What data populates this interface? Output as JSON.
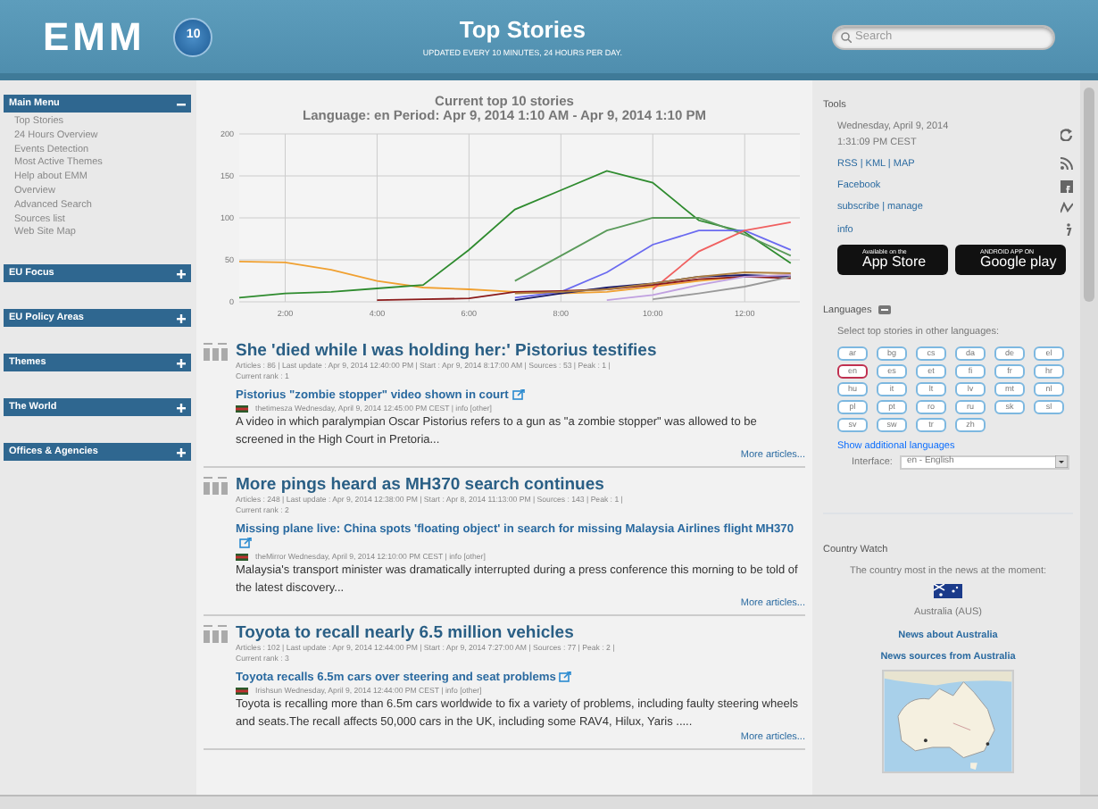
{
  "header": {
    "logo": "EMM",
    "badge": "10",
    "title": "Top Stories",
    "subtitle": "UPDATED EVERY 10 MINUTES, 24 HOURS PER DAY.",
    "search": {
      "placeholder": "Search"
    }
  },
  "sidebar": {
    "panels": [
      {
        "title": "Main Menu",
        "expanded": true,
        "items": [
          "Top Stories",
          "24 Hours Overview",
          "Events Detection",
          "Most Active Themes",
          "Help about EMM",
          "Overview",
          "Advanced Search",
          "Sources list",
          "Web Site Map"
        ]
      },
      {
        "title": "EU Focus",
        "expanded": false
      },
      {
        "title": "EU Policy Areas",
        "expanded": false
      },
      {
        "title": "Themes",
        "expanded": false
      },
      {
        "title": "The World",
        "expanded": false
      },
      {
        "title": "Offices & Agencies",
        "expanded": false
      }
    ]
  },
  "chart": {
    "chart_data": {
      "type": "line",
      "grid": true,
      "title": "Current top 10 stories",
      "subtitle": "Language: en Period: Apr 9, 2014 1:10 AM - Apr 9, 2014 1:10 PM",
      "x": [
        1,
        2,
        3,
        4,
        5,
        6,
        7,
        8,
        9,
        10,
        11,
        12,
        13
      ],
      "xlim": [
        1,
        13.2
      ],
      "ylim": [
        0,
        200
      ],
      "yticks": [
        0,
        50,
        100,
        150,
        200
      ],
      "xticks": [
        {
          "value": 2,
          "label": "2:00"
        },
        {
          "value": 4,
          "label": "4:00"
        },
        {
          "value": 6,
          "label": "6:00"
        },
        {
          "value": 8,
          "label": "8:00"
        },
        {
          "value": 10,
          "label": "10:00"
        },
        {
          "value": 12,
          "label": "12:00"
        }
      ],
      "series": [
        {
          "color": "#f0a030",
          "values": [
            48,
            47,
            38,
            25,
            17,
            15,
            12,
            10,
            12,
            18,
            25,
            30,
            32
          ]
        },
        {
          "color": "#2e8b2e",
          "values": [
            5,
            10,
            12,
            16,
            20,
            62,
            110,
            133,
            156,
            142,
            97,
            83,
            46
          ]
        },
        {
          "color": "#5a9a5a",
          "values": [
            null,
            null,
            null,
            null,
            null,
            null,
            25,
            55,
            85,
            100,
            100,
            80,
            55
          ]
        },
        {
          "color": "#6a6af0",
          "values": [
            null,
            null,
            null,
            null,
            null,
            null,
            5,
            12,
            35,
            68,
            85,
            85,
            62
          ]
        },
        {
          "color": "#f06060",
          "values": [
            null,
            null,
            null,
            null,
            null,
            null,
            null,
            null,
            null,
            15,
            60,
            85,
            95
          ]
        },
        {
          "color": "#8b1a1a",
          "values": [
            null,
            null,
            null,
            2,
            3,
            4,
            12,
            13,
            15,
            20,
            27,
            30,
            28
          ]
        },
        {
          "color": "#1a1a6a",
          "values": [
            null,
            null,
            null,
            null,
            null,
            null,
            2,
            10,
            17,
            22,
            30,
            32,
            30
          ]
        },
        {
          "color": "#999999",
          "values": [
            null,
            null,
            null,
            null,
            null,
            null,
            null,
            null,
            null,
            3,
            10,
            18,
            30
          ]
        },
        {
          "color": "#c0a0e0",
          "values": [
            null,
            null,
            null,
            null,
            null,
            null,
            null,
            null,
            2,
            8,
            20,
            30,
            32
          ]
        },
        {
          "color": "#b08040",
          "values": [
            null,
            null,
            null,
            null,
            null,
            null,
            10,
            12,
            15,
            22,
            30,
            35,
            34
          ]
        }
      ]
    }
  },
  "stories": [
    {
      "title": "She 'died while I was holding her:' Pistorius testifies",
      "meta": "Articles : 86 | Last update : Apr 9, 2014 12:40:00 PM | Start : Apr 9, 2014 8:17:00 AM | Sources : 53 | Peak : 1 |",
      "rank": "Current rank : 1",
      "article": {
        "title": "Pistorius \"zombie stopper\" video shown in court",
        "source": "thetimesza Wednesday, April 9, 2014 12:45:00 PM CEST | info [other]",
        "text": "A video in which paralympian Oscar Pistorius refers to a gun as \"a zombie stopper\" was allowed to be screened in the High Court in Pretoria..."
      },
      "more": "More articles..."
    },
    {
      "title": "More pings heard as MH370 search continues",
      "meta": "Articles : 248 | Last update : Apr 9, 2014 12:38:00 PM | Start : Apr 8, 2014 11:13:00 PM | Sources : 143 | Peak : 1 |",
      "rank": "Current rank : 2",
      "article": {
        "title": "Missing plane live: China spots 'floating object' in search for missing Malaysia Airlines flight MH370",
        "source": "theMirror Wednesday, April 9, 2014 12:10:00 PM CEST | info [other]",
        "text": "Malaysia's transport minister was dramatically interrupted during a press conference this morning to be told of the latest discovery..."
      },
      "more": "More articles..."
    },
    {
      "title": "Toyota to recall nearly 6.5 million vehicles",
      "meta": "Articles : 102 | Last update : Apr 9, 2014 12:44:00 PM | Start : Apr 9, 2014 7:27:00 AM | Sources : 77 | Peak : 2 |",
      "rank": "Current rank : 3",
      "article": {
        "title": "Toyota recalls 6.5m cars over steering and seat problems",
        "source": "Irishsun Wednesday, April 9, 2014 12:44:00 PM CEST | info [other]",
        "text": "Toyota is recalling more than 6.5m cars worldwide to fix a variety of problems, including faulty steering wheels and seats.The recall affects 50,000 cars in the UK, including some RAV4, Hilux, Yaris ....."
      },
      "more": "More articles..."
    }
  ],
  "tools": {
    "heading": "Tools",
    "date": "Wednesday, April 9, 2014",
    "time": "1:31:09 PM CEST",
    "links": [
      "RSS | KML | MAP",
      "Facebook",
      "subscribe | manage",
      "info"
    ],
    "stores": [
      {
        "small": "Available on the",
        "big": "App Store"
      },
      {
        "small": "ANDROID APP ON",
        "big": "Google play"
      }
    ]
  },
  "languages": {
    "heading": "Languages",
    "prompt": "Select top stories in other languages:",
    "codes": [
      {
        "label": "ar",
        "selected": false
      },
      {
        "label": "bg",
        "selected": false
      },
      {
        "label": "cs",
        "selected": false
      },
      {
        "label": "da",
        "selected": false
      },
      {
        "label": "de",
        "selected": false
      },
      {
        "label": "el",
        "selected": false
      },
      {
        "label": "en",
        "selected": true
      },
      {
        "label": "es",
        "selected": false
      },
      {
        "label": "et",
        "selected": false
      },
      {
        "label": "fi",
        "selected": false
      },
      {
        "label": "fr",
        "selected": false
      },
      {
        "label": "hr",
        "selected": false
      },
      {
        "label": "hu",
        "selected": false
      },
      {
        "label": "it",
        "selected": false
      },
      {
        "label": "lt",
        "selected": false
      },
      {
        "label": "lv",
        "selected": false
      },
      {
        "label": "mt",
        "selected": false
      },
      {
        "label": "nl",
        "selected": false
      },
      {
        "label": "pl",
        "selected": false
      },
      {
        "label": "pt",
        "selected": false
      },
      {
        "label": "ro",
        "selected": false
      },
      {
        "label": "ru",
        "selected": false
      },
      {
        "label": "sk",
        "selected": false
      },
      {
        "label": "sl",
        "selected": false
      },
      {
        "label": "sv",
        "selected": false
      },
      {
        "label": "sw",
        "selected": false
      },
      {
        "label": "tr",
        "selected": false
      },
      {
        "label": "zh",
        "selected": false
      }
    ],
    "more": "Show additional languages",
    "interface_label": "Interface:",
    "interface_value": "en - English"
  },
  "country_watch": {
    "heading": "Country Watch",
    "prompt": "The country most in the news at the moment:",
    "country": "Australia (AUS)",
    "links": [
      "News about Australia",
      "News sources from Australia"
    ],
    "map": {
      "kind": "picture"
    }
  }
}
